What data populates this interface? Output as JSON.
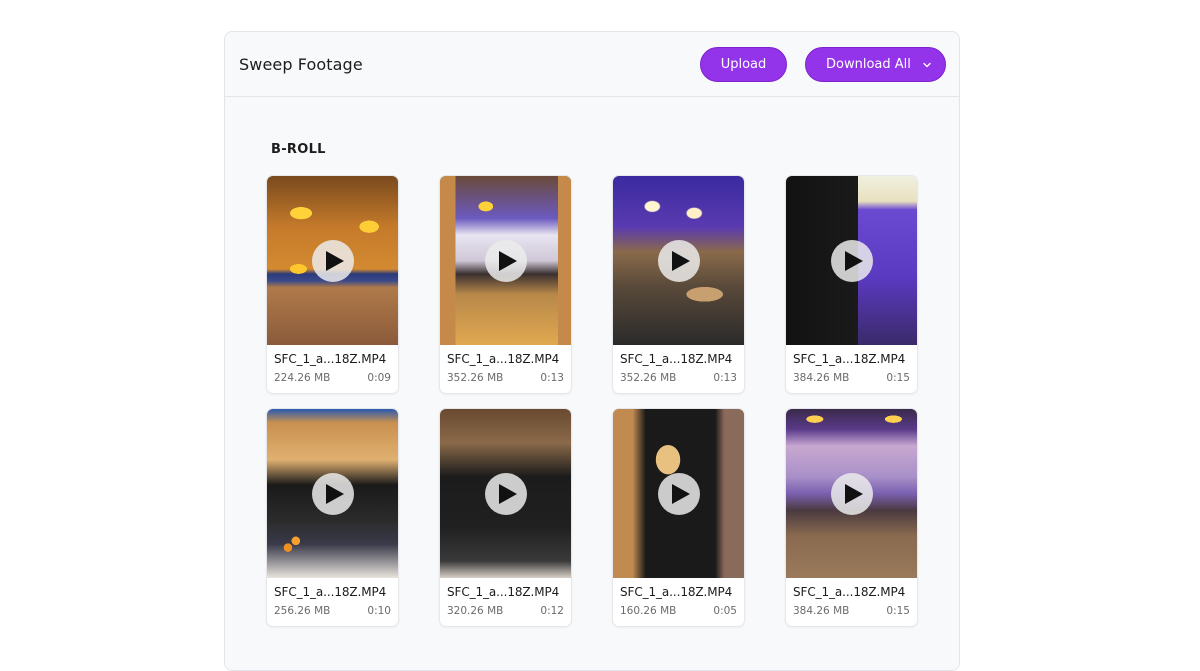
{
  "header": {
    "title": "Sweep Footage",
    "upload_label": "Upload",
    "download_all_label": "Download All"
  },
  "colors": {
    "accent": "#9333ea",
    "panel_bg": "#f8f9fb",
    "border": "#e3e5ea"
  },
  "section": {
    "label": "B-ROLL"
  },
  "videos": [
    {
      "filename": "SFC_1_a...18Z.MP4",
      "size": "224.26 MB",
      "duration": "0:09"
    },
    {
      "filename": "SFC_1_a...18Z.MP4",
      "size": "352.26 MB",
      "duration": "0:13"
    },
    {
      "filename": "SFC_1_a...18Z.MP4",
      "size": "352.26 MB",
      "duration": "0:13"
    },
    {
      "filename": "SFC_1_a...18Z.MP4",
      "size": "384.26 MB",
      "duration": "0:15"
    },
    {
      "filename": "SFC_1_a...18Z.MP4",
      "size": "256.26 MB",
      "duration": "0:10"
    },
    {
      "filename": "SFC_1_a...18Z.MP4",
      "size": "320.26 MB",
      "duration": "0:12"
    },
    {
      "filename": "SFC_1_a...18Z.MP4",
      "size": "160.26 MB",
      "duration": "0:05"
    },
    {
      "filename": "SFC_1_a...18Z.MP4",
      "size": "384.26 MB",
      "duration": "0:15"
    }
  ]
}
